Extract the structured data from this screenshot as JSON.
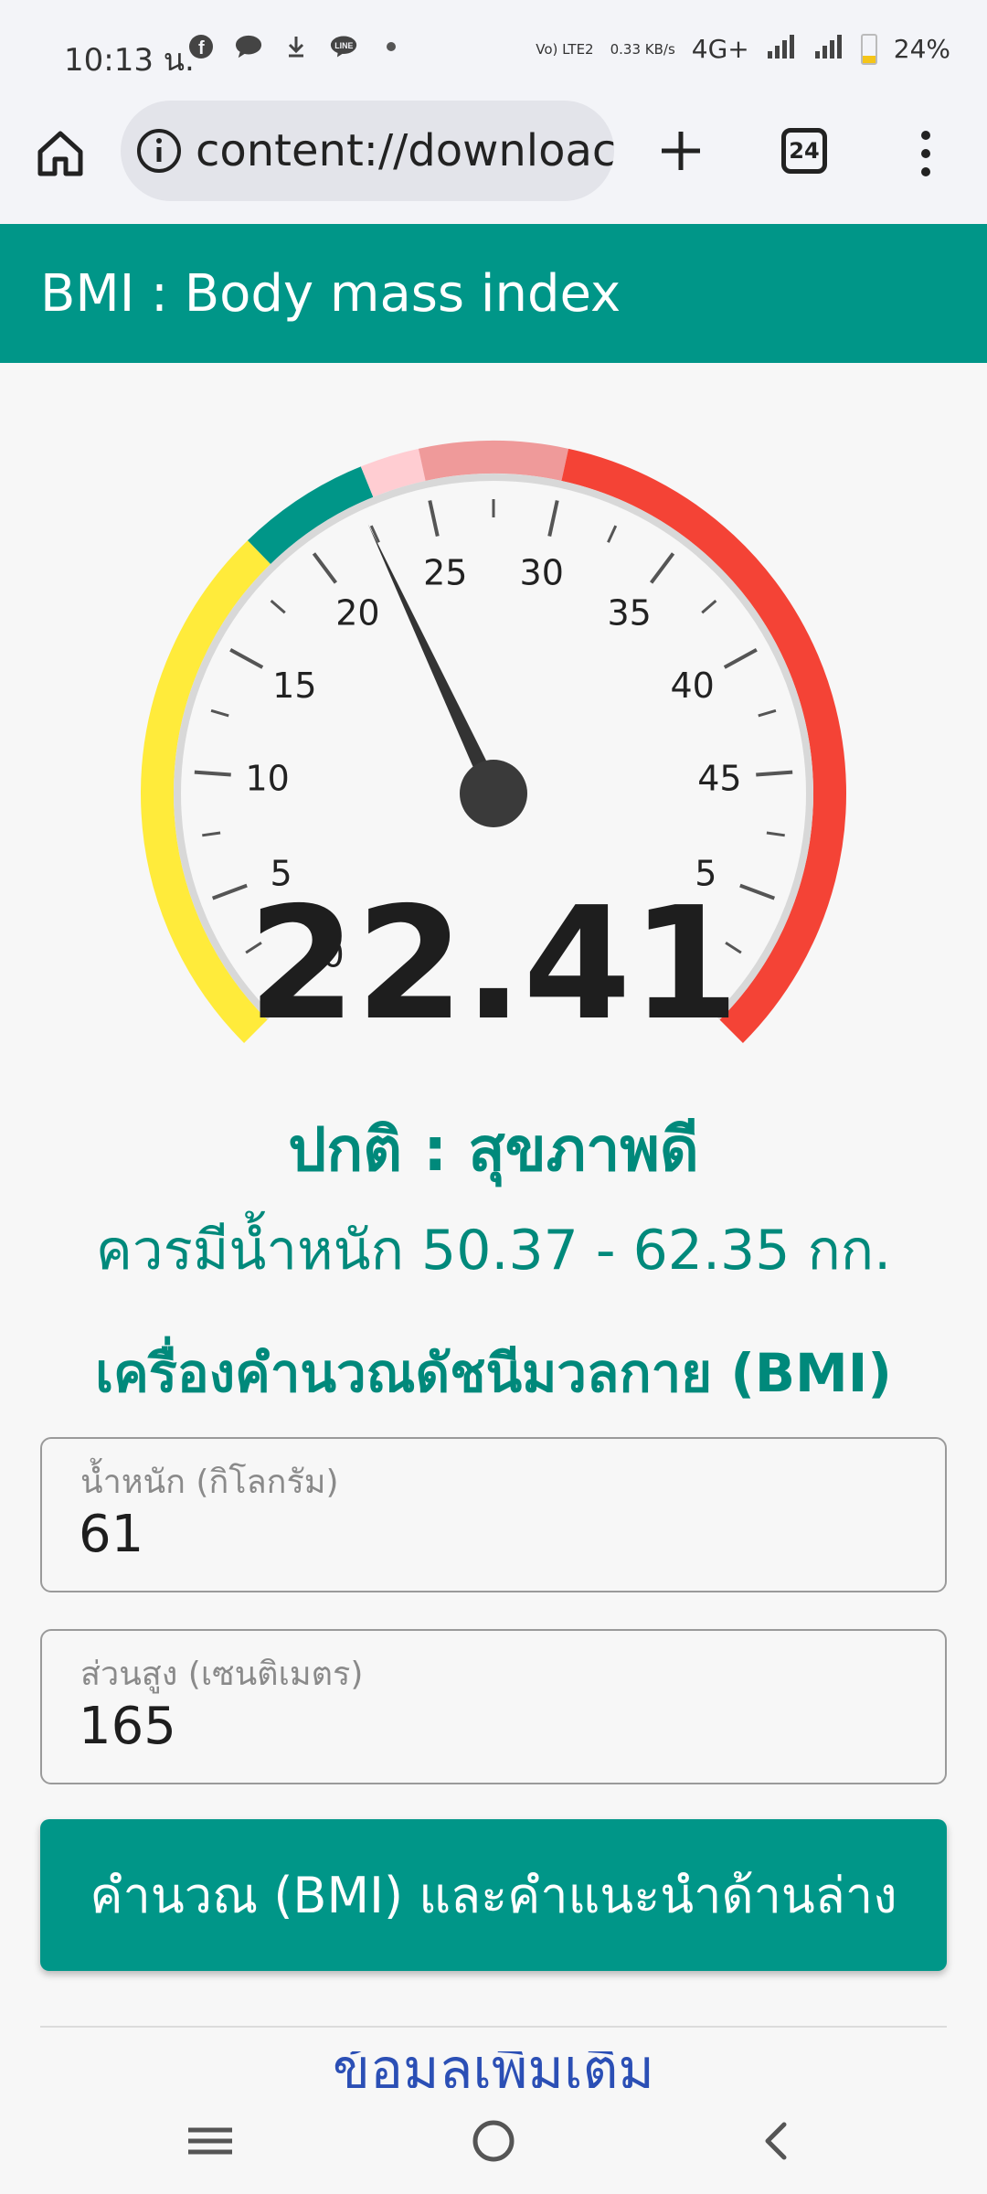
{
  "status_bar": {
    "time": "10:13 น.",
    "net_type": "Vo) LTE2",
    "speed": "0.33 KB/s",
    "signal_label": "4G+",
    "battery": "24%",
    "battery_level": 0.24
  },
  "browser": {
    "url": "content://downloac",
    "tab_count": "24"
  },
  "app": {
    "title": "BMI : Body mass index"
  },
  "gauge": {
    "value": 22.41,
    "min": 0,
    "max": 55,
    "major_labels": [
      "0",
      "5",
      "10",
      "15",
      "20",
      "25",
      "30",
      "35",
      "40",
      "45",
      "5"
    ],
    "bands": [
      {
        "from": 0,
        "to": 18.5,
        "color": "#ffeb3b"
      },
      {
        "from": 18.5,
        "to": 23,
        "color": "#009688"
      },
      {
        "from": 23,
        "to": 25,
        "color": "#ffcdd2"
      },
      {
        "from": 25,
        "to": 30,
        "color": "#ef9a9a"
      },
      {
        "from": 30,
        "to": 55,
        "color": "#f44336"
      }
    ]
  },
  "result": {
    "bmi_value": "22.41",
    "status": "ปกติ : สุขภาพดี",
    "advice": "ควรมีน้ำหนัก 50.37 - 62.35 กก."
  },
  "form": {
    "title": "เครื่องคำนวณดัชนีมวลกาย (BMI)",
    "weight_label": "น้ำหนัก (กิโลกรัม)",
    "weight_value": "61",
    "height_label": "ส่วนสูง (เซนติเมตร)",
    "height_value": "165",
    "button_label": "คำนวณ (BMI) และคำแนะนำด้านล่าง"
  },
  "partial_link": "ข้อมูลเพิ่มเติม",
  "colors": {
    "primary": "#009688",
    "accent_text": "#00897b"
  }
}
